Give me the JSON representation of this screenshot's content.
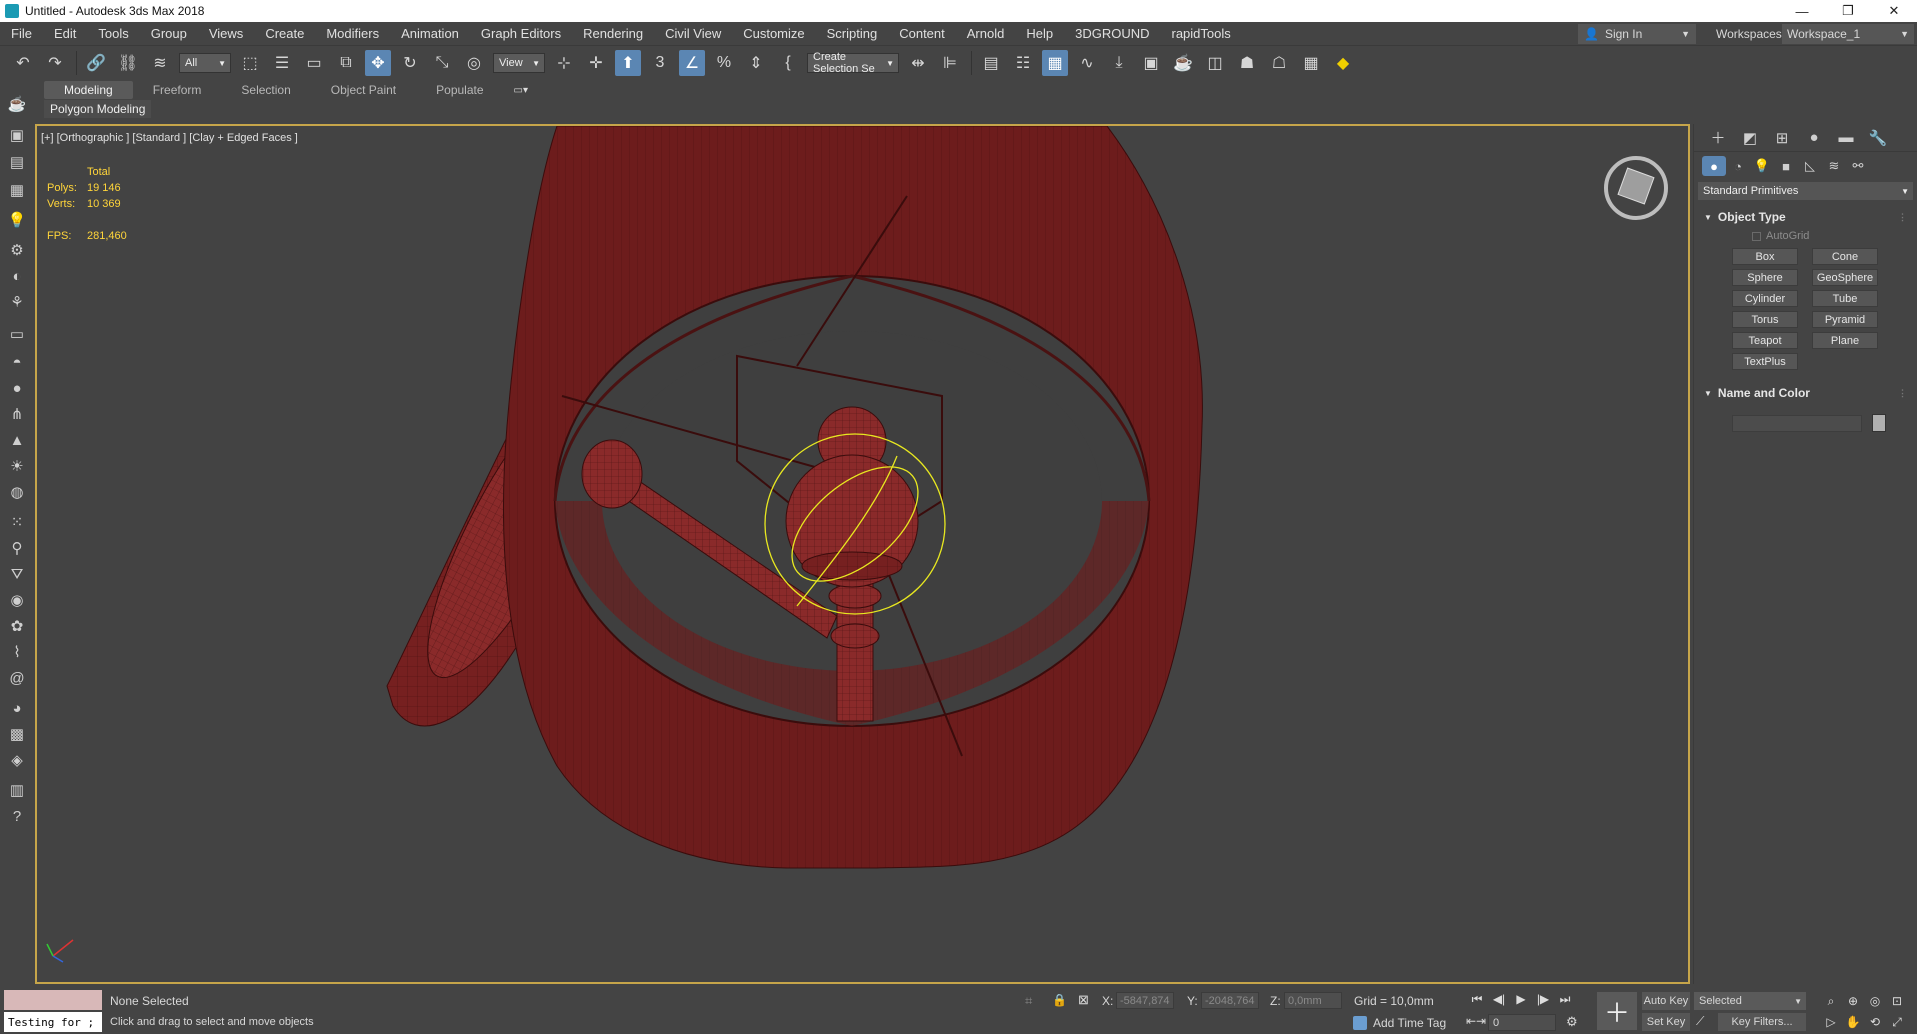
{
  "window": {
    "title": "Untitled - Autodesk 3ds Max 2018",
    "min": "—",
    "restore": "❐",
    "close": "✕"
  },
  "menu": [
    "File",
    "Edit",
    "Tools",
    "Group",
    "Views",
    "Create",
    "Modifiers",
    "Animation",
    "Graph Editors",
    "Rendering",
    "Civil View",
    "Customize",
    "Scripting",
    "Content",
    "Arnold",
    "Help",
    "3DGROUND",
    "rapidTools"
  ],
  "account": {
    "sign_in": "Sign In",
    "workspaces_label": "Workspaces:",
    "workspace": "Workspace_1"
  },
  "toolbar": {
    "filter": "All",
    "ref_coord": "View",
    "selection_set": "Create Selection Se"
  },
  "ribbon": {
    "tabs": [
      "Modeling",
      "Freeform",
      "Selection",
      "Object Paint",
      "Populate"
    ],
    "panel": "Polygon Modeling"
  },
  "viewport": {
    "label": "[+] [Orthographic ] [Standard ] [Clay + Edged Faces ]",
    "stats": {
      "total": "Total",
      "polys_label": "Polys:",
      "polys": "19 146",
      "verts_label": "Verts:",
      "verts": "10 369",
      "fps_label": "FPS:",
      "fps": "281,460"
    }
  },
  "command_panel": {
    "category": "Standard Primitives",
    "object_type_title": "Object Type",
    "autogrid": "AutoGrid",
    "object_buttons": [
      "Box",
      "Cone",
      "Sphere",
      "GeoSphere",
      "Cylinder",
      "Tube",
      "Torus",
      "Pyramid",
      "Teapot",
      "Plane",
      "TextPlus"
    ],
    "name_color_title": "Name and Color"
  },
  "status": {
    "maxscript": "Testing for ;",
    "selection": "None Selected",
    "prompt": "Click and drag to select and move objects",
    "x_label": "X:",
    "x": "-5847,874",
    "y_label": "Y:",
    "y": "-2048,764",
    "z_label": "Z:",
    "z": "0,0mm",
    "grid": "Grid = 10,0mm",
    "add_time_tag": "Add Time Tag",
    "frame": "0",
    "auto_key": "Auto Key",
    "set_key": "Set Key",
    "key_mode": "Selected",
    "key_filters": "Key Filters..."
  },
  "colors": {
    "viewport_border": "#c6a54a",
    "stats_text": "#ffd53a",
    "model": "#7a1f1f",
    "selection_gizmo": "#e8e820",
    "active_tool": "#5b86b3"
  }
}
